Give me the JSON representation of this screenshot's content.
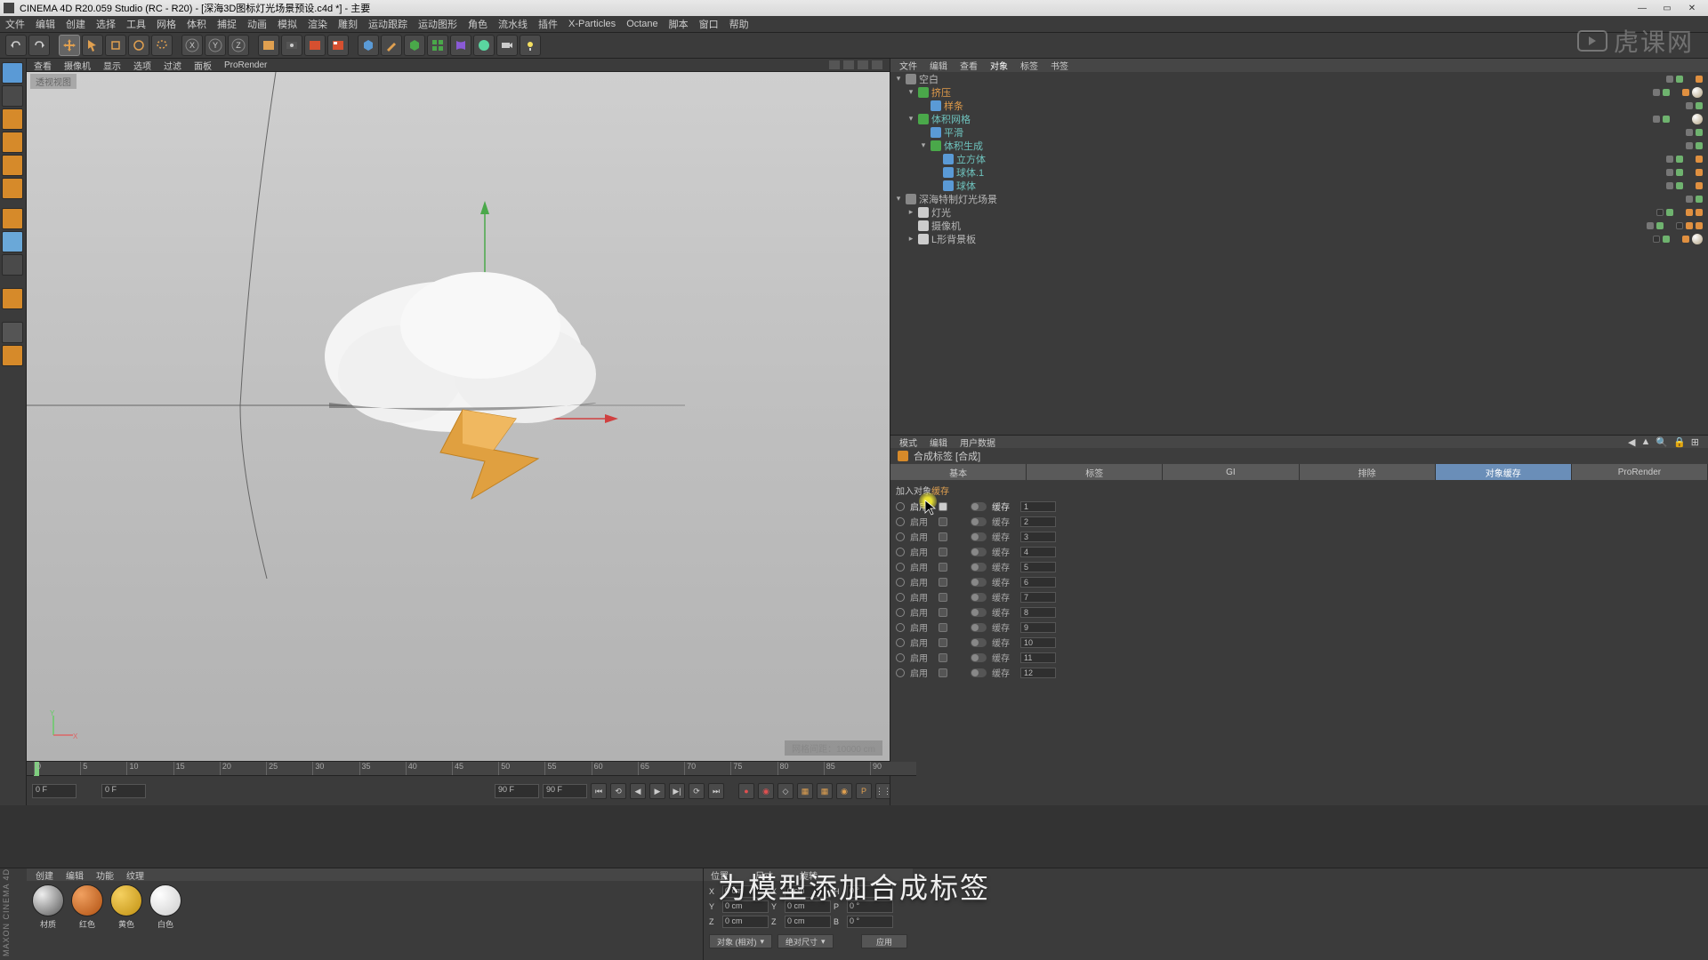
{
  "title": "CINEMA 4D R20.059 Studio (RC - R20) - [深海3D图标灯光场景预设.c4d *] - 主要",
  "menus": [
    "文件",
    "编辑",
    "创建",
    "选择",
    "工具",
    "网格",
    "体积",
    "捕捉",
    "动画",
    "模拟",
    "渲染",
    "雕刻",
    "运动跟踪",
    "运动图形",
    "角色",
    "流水线",
    "插件",
    "X-Particles",
    "Octane",
    "脚本",
    "窗口",
    "帮助"
  ],
  "vp_menu": [
    "查看",
    "摄像机",
    "显示",
    "选项",
    "过滤",
    "面板",
    "ProRender"
  ],
  "vp_tag": "透视视图",
  "vp_info": "网格间距：10000 cm",
  "subtitle": "为模型添加合成标签",
  "watermark": "虎课网",
  "timeline": {
    "marks": [
      "0",
      "5",
      "10",
      "15",
      "20",
      "25",
      "30",
      "35",
      "40",
      "45",
      "50",
      "55",
      "60",
      "65",
      "70",
      "75",
      "80",
      "85",
      "90"
    ],
    "f0": "0 F",
    "f1": "0 F",
    "f90a": "90 F",
    "f90b": "90 F"
  },
  "obj_tabs": [
    "文件",
    "编辑",
    "查看",
    "对象",
    "标签",
    "书签"
  ],
  "objects": [
    {
      "d": 0,
      "t": "open",
      "i": "#888",
      "n": "空白",
      "c": "",
      "tags": [
        "gr",
        "g",
        "",
        "or"
      ]
    },
    {
      "d": 1,
      "t": "open",
      "i": "#4aa84a",
      "n": "挤压",
      "c": "orange",
      "tags": [
        "gr",
        "g",
        "",
        "or",
        "ball"
      ]
    },
    {
      "d": 2,
      "t": "",
      "i": "#5a9ad6",
      "n": "样条",
      "c": "orange",
      "tags": [
        "gr",
        "g"
      ]
    },
    {
      "d": 1,
      "t": "open",
      "i": "#4aa84a",
      "n": "体积网格",
      "c": "teal",
      "tags": [
        "gr",
        "g",
        "",
        "",
        "ball"
      ]
    },
    {
      "d": 2,
      "t": "",
      "i": "#5a9ad6",
      "n": "平滑",
      "c": "teal",
      "tags": [
        "gr",
        "g"
      ]
    },
    {
      "d": 2,
      "t": "open",
      "i": "#4aa84a",
      "n": "体积生成",
      "c": "teal",
      "tags": [
        "gr",
        "g"
      ]
    },
    {
      "d": 3,
      "t": "",
      "i": "#5a9ad6",
      "n": "立方体",
      "c": "teal",
      "tags": [
        "gr",
        "g",
        "",
        "or"
      ]
    },
    {
      "d": 3,
      "t": "",
      "i": "#5a9ad6",
      "n": "球体.1",
      "c": "teal",
      "tags": [
        "gr",
        "g",
        "",
        "or"
      ]
    },
    {
      "d": 3,
      "t": "",
      "i": "#5a9ad6",
      "n": "球体",
      "c": "teal",
      "tags": [
        "gr",
        "g",
        "",
        "or"
      ]
    },
    {
      "d": 0,
      "t": "open",
      "i": "#888",
      "n": "深海特制灯光场景",
      "c": "",
      "tags": [
        "gr",
        "g"
      ]
    },
    {
      "d": 1,
      "t": "closed",
      "i": "#ccc",
      "n": "灯光",
      "c": "",
      "tags": [
        "bk",
        "g",
        "",
        "or",
        "or"
      ]
    },
    {
      "d": 1,
      "t": "",
      "i": "#ccc",
      "n": "摄像机",
      "c": "",
      "tags": [
        "gr",
        "g",
        "",
        "bk",
        "or",
        "or"
      ]
    },
    {
      "d": 1,
      "t": "closed",
      "i": "#ccc",
      "n": "L形背景板",
      "c": "",
      "tags": [
        "bk",
        "g",
        "",
        "or",
        "ball"
      ]
    }
  ],
  "attr_tabs": [
    "模式",
    "编辑",
    "用户数据"
  ],
  "attr_title": "合成标签 [合成]",
  "attr_row_tabs": [
    "基本",
    "标签",
    "GI",
    "排除",
    "对象缓存",
    "ProRender"
  ],
  "attr_section": "加入对象",
  "attr_section_hl": "缓存",
  "buf": {
    "enable": "启用",
    "buffer": "缓存",
    "values": [
      "1",
      "2",
      "3",
      "4",
      "5",
      "6",
      "7",
      "8",
      "9",
      "10",
      "11",
      "12"
    ]
  },
  "mat_tabs": [
    "创建",
    "编辑",
    "功能",
    "纹理"
  ],
  "materials": [
    {
      "name": "材质",
      "bg": "radial-gradient(circle at 30% 30%, #eee, #555)"
    },
    {
      "name": "红色",
      "bg": "radial-gradient(circle at 30% 30%, #f0a060, #b05010)"
    },
    {
      "name": "黄色",
      "bg": "radial-gradient(circle at 30% 30%, #f5d060, #c09010)"
    },
    {
      "name": "白色",
      "bg": "radial-gradient(circle at 30% 30%, #fff, #ccc)"
    }
  ],
  "coord_tabs": [
    "位置",
    "尺寸",
    "旋转"
  ],
  "coords": {
    "x": {
      "p": "0 cm",
      "s": "0 cm",
      "r": "0 °"
    },
    "y": {
      "p": "0 cm",
      "s": "0 cm",
      "r": "0 °"
    },
    "z": {
      "p": "0 cm",
      "s": "0 cm",
      "r": "0 °"
    }
  },
  "coord_mode1": "对象 (相对)",
  "coord_mode2": "绝对尺寸",
  "coord_apply": "应用",
  "sidelabel": "MAXON CINEMA 4D"
}
